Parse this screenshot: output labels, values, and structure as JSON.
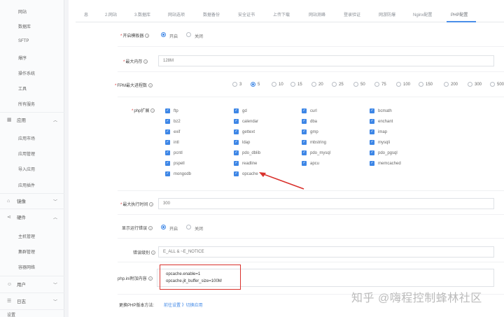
{
  "sidebar": {
    "items_top": [
      "网站",
      "数据库",
      "SFTP",
      "爆序",
      "操作系统",
      "工具",
      "所有服务"
    ],
    "groups": [
      {
        "icon": "grid-icon",
        "label": "应用",
        "children": [
          "应用市场",
          "应用管理",
          "导入应用",
          "应用插件"
        ]
      },
      {
        "icon": "home-icon",
        "label": "镜像",
        "children": []
      },
      {
        "icon": "share-icon",
        "label": "硬件",
        "children": [
          "主机管理",
          "集群管理",
          "容器网络"
        ]
      },
      {
        "icon": "user-icon",
        "label": "用户",
        "children": []
      },
      {
        "icon": "log-icon",
        "label": "日志",
        "children": []
      }
    ],
    "bottom_partial": "设置"
  },
  "tabs": [
    "息",
    "2.网站",
    "3.数据库",
    "网站选项",
    "数据备份",
    "安全证书",
    "上传下载",
    "网站测峰",
    "登录验证",
    "网游防爆",
    "Nginx配置",
    "PHP配置"
  ],
  "active_tab": "PHP配置",
  "form": {
    "enable_op": {
      "label": "开启模板器",
      "options": [
        "开启",
        "关闭"
      ],
      "selected": "开启"
    },
    "max_memory": {
      "label": "最大内存",
      "value": "128M"
    },
    "fpm_max": {
      "label": "FPM最大进程数",
      "options": [
        "3",
        "5",
        "10",
        "15",
        "20",
        "25",
        "50",
        "75",
        "100",
        "150",
        "200",
        "300",
        "500"
      ],
      "selected": "5"
    },
    "php_ext": {
      "label": "php扩展",
      "columns": [
        [
          "ftp",
          "bz2",
          "exif",
          "intl",
          "pcntl",
          "pspell",
          "mongodb"
        ],
        [
          "gd",
          "calendar",
          "gettext",
          "ldap",
          "pdo_dblib",
          "readline",
          "opcache"
        ],
        [
          "curl",
          "dba",
          "gmp",
          "mbstring",
          "pdo_mysql",
          "apcu"
        ],
        [
          "bcmath",
          "enchant",
          "imap",
          "mysqli",
          "pdo_pgsql",
          "memcached"
        ]
      ]
    },
    "max_exec_time": {
      "label": "最大执行时间",
      "value": "300"
    },
    "display_errors": {
      "label": "显示运行错误",
      "options": [
        "开启",
        "关闭"
      ],
      "selected": "开启"
    },
    "error_level": {
      "label": "错误级别",
      "value": "E_ALL & ~E_NOTICE"
    },
    "php_ini": {
      "label": "php.ini附加内容",
      "lines": [
        "opcache.enable=1",
        "opcache.jit_buffer_size=100M"
      ]
    },
    "change_version": {
      "label": "更换PHP版本方法:",
      "link": "前往设置 》切换应用"
    }
  },
  "watermark": "知乎 @嗨程控制蜂林社区",
  "colors": {
    "accent": "#3d86e6",
    "highlight": "#d9312c"
  }
}
